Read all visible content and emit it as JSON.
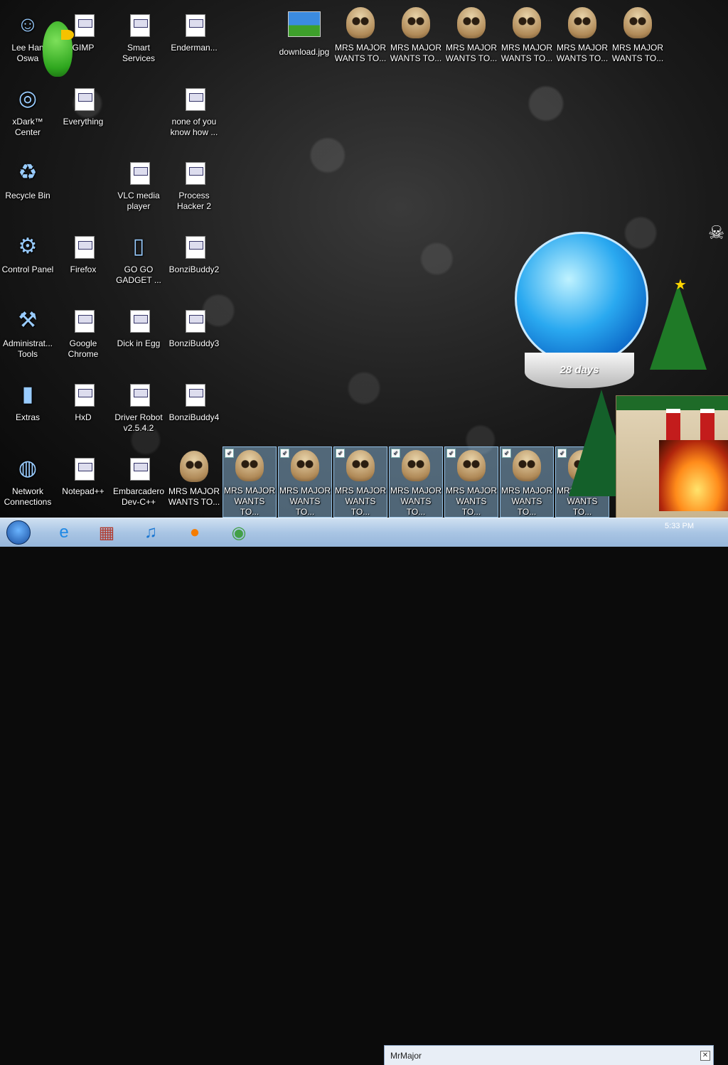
{
  "desktop": {
    "icons": [
      {
        "label": "Lee Han\nOswa",
        "glyph": "person",
        "col": 0,
        "row": 0
      },
      {
        "label": "xDark™\nCenter",
        "glyph": "disc",
        "col": 0,
        "row": 1
      },
      {
        "label": "Recycle Bin",
        "glyph": "recycle-bin",
        "col": 0,
        "row": 2
      },
      {
        "label": "Control Panel",
        "glyph": "control-panel",
        "col": 0,
        "row": 3
      },
      {
        "label": "Administrat...\nTools",
        "glyph": "tools",
        "col": 0,
        "row": 4
      },
      {
        "label": "Extras",
        "glyph": "folder",
        "col": 0,
        "row": 5
      },
      {
        "label": "Network\nConnections",
        "glyph": "network",
        "col": 0,
        "row": 6
      },
      {
        "label": "GIMP",
        "glyph": "doc",
        "col": 1,
        "row": 0
      },
      {
        "label": "Everything",
        "glyph": "doc",
        "col": 1,
        "row": 1
      },
      {
        "label": "Firefox",
        "glyph": "doc",
        "col": 1,
        "row": 3
      },
      {
        "label": "Google\nChrome",
        "glyph": "doc",
        "col": 1,
        "row": 4
      },
      {
        "label": "HxD",
        "glyph": "doc",
        "col": 1,
        "row": 5
      },
      {
        "label": "Notepad++",
        "glyph": "doc",
        "col": 1,
        "row": 6
      },
      {
        "label": "Smart\nServices",
        "glyph": "doc",
        "col": 2,
        "row": 0
      },
      {
        "label": "VLC media\nplayer",
        "glyph": "doc",
        "col": 2,
        "row": 2
      },
      {
        "label": "GO GO\nGADGET ...",
        "glyph": "tablet",
        "col": 2,
        "row": 3
      },
      {
        "label": "Dick in Egg",
        "glyph": "doc",
        "col": 2,
        "row": 4
      },
      {
        "label": "Driver Robot\nv2.5.4.2",
        "glyph": "doc",
        "col": 2,
        "row": 5
      },
      {
        "label": "Embarcadero\nDev-C++",
        "glyph": "doc",
        "col": 2,
        "row": 6
      },
      {
        "label": "Enderman...",
        "glyph": "doc",
        "col": 3,
        "row": 0
      },
      {
        "label": "none of you\nknow how ...",
        "glyph": "doc",
        "col": 3,
        "row": 1
      },
      {
        "label": "Process\nHacker 2",
        "glyph": "doc",
        "col": 3,
        "row": 2
      },
      {
        "label": "BonziBuddy2",
        "glyph": "doc",
        "col": 3,
        "row": 3
      },
      {
        "label": "BonziBuddy3",
        "glyph": "doc",
        "col": 3,
        "row": 4
      },
      {
        "label": "BonziBuddy4",
        "glyph": "doc",
        "col": 3,
        "row": 5
      },
      {
        "label": "MRS MAJOR\nWANTS TO...",
        "glyph": "skull",
        "col": 3,
        "row": 6
      }
    ],
    "top_row": [
      {
        "label": "download.jpg",
        "glyph": "image"
      },
      {
        "label": "MRS MAJOR\nWANTS TO...",
        "glyph": "skull"
      },
      {
        "label": "MRS MAJOR\nWANTS TO...",
        "glyph": "skull"
      },
      {
        "label": "MRS MAJOR\nWANTS TO...",
        "glyph": "skull"
      },
      {
        "label": "MRS MAJOR\nWANTS TO...",
        "glyph": "skull"
      },
      {
        "label": "MRS MAJOR\nWANTS TO...",
        "glyph": "skull"
      },
      {
        "label": "MRS MAJOR\nWANTS TO...",
        "glyph": "skull"
      }
    ],
    "selected_row": [
      {
        "label": "MRS MAJOR\nWANTS TO..."
      },
      {
        "label": "MRS MAJOR\nWANTS TO..."
      },
      {
        "label": "MRS MAJOR\nWANTS TO..."
      },
      {
        "label": "MRS MAJOR\nWANTS TO..."
      },
      {
        "label": "MRS MAJOR\nWANTS TO..."
      },
      {
        "label": "MRS MAJOR\nWANTS TO..."
      },
      {
        "label": "MRS MAJOR\nWANTS TO..."
      }
    ],
    "snowglobe": {
      "countdown": "28 days"
    }
  },
  "taskbar": {
    "pinned": [
      {
        "name": "internet-explorer-icon",
        "glyph": "e",
        "color": "#1e88e5"
      },
      {
        "name": "store-icon",
        "glyph": "▦",
        "color": "#b03a2e"
      },
      {
        "name": "music-icon",
        "glyph": "♫",
        "color": "#1976d2"
      },
      {
        "name": "firefox-icon",
        "glyph": "●",
        "color": "#f57c00"
      },
      {
        "name": "chrome-icon",
        "glyph": "◉",
        "color": "#43a047"
      }
    ],
    "window_title": "MrMajor",
    "clock": "5:33 PM"
  },
  "colors": {
    "selection": "#99c9ef",
    "taskbar": "#a9c5e4"
  }
}
